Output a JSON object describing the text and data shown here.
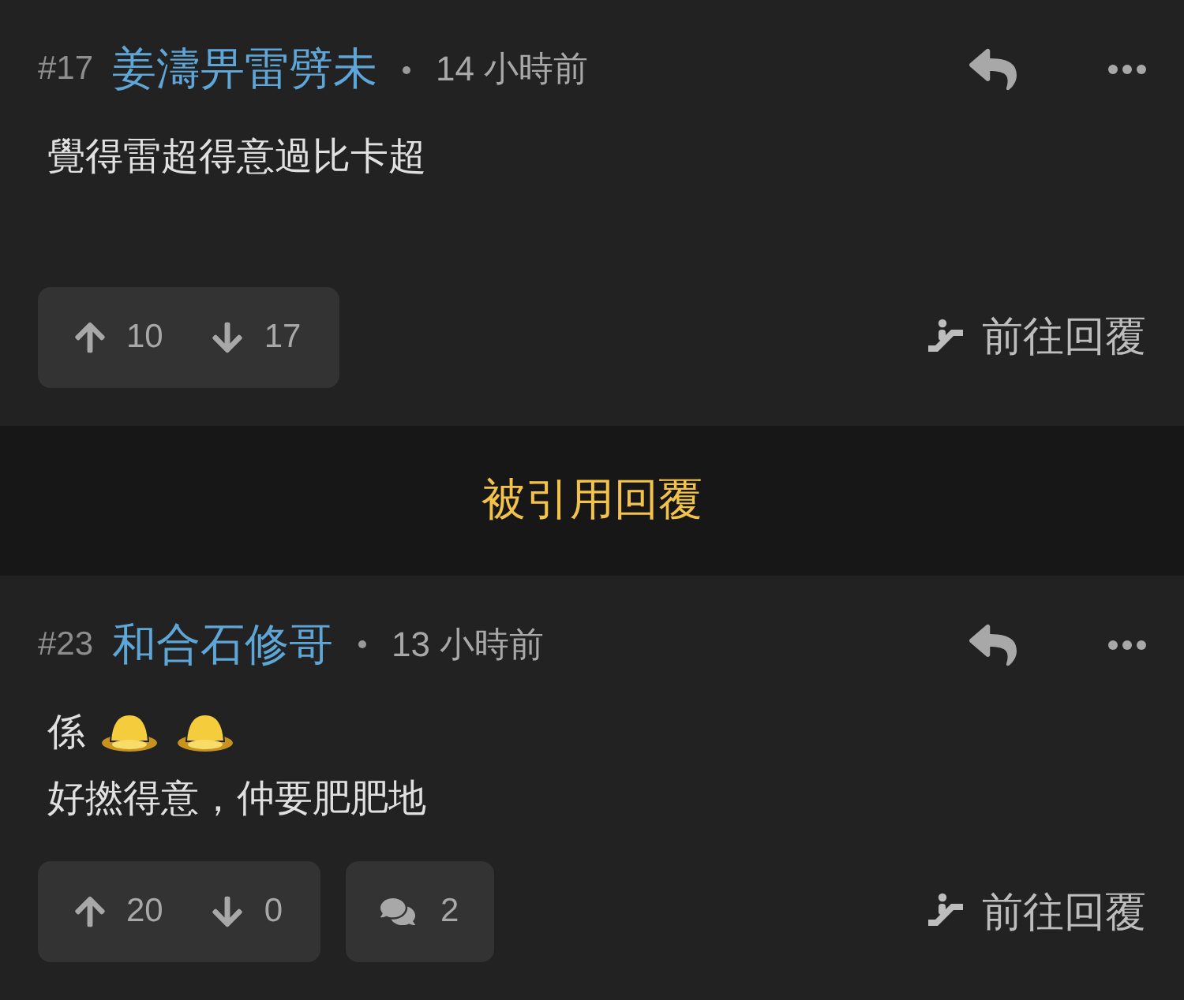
{
  "posts": [
    {
      "number": "#17",
      "author": "姜濤畀雷劈未",
      "time": "14 小時前",
      "body": [
        {
          "segments": [
            {
              "kind": "text",
              "text": "覺得雷超得意過比卡超"
            }
          ]
        }
      ],
      "upvotes": "10",
      "downvotes": "17",
      "goto": "前往回覆"
    },
    {
      "number": "#23",
      "author": "和合石修哥",
      "time": "13 小時前",
      "body": [
        {
          "segments": [
            {
              "kind": "text",
              "text": "係"
            },
            {
              "kind": "emoji"
            },
            {
              "kind": "emoji"
            }
          ]
        },
        {
          "segments": [
            {
              "kind": "text",
              "text": "好撚得意，仲要肥肥地"
            }
          ]
        }
      ],
      "upvotes": "20",
      "downvotes": "0",
      "comments": "2",
      "goto": "前往回覆"
    }
  ],
  "divider_banner": "被引用回覆"
}
